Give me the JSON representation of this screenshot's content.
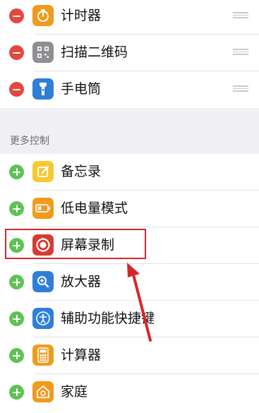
{
  "included_controls": [
    {
      "label": "计时器",
      "icon": "timer-icon",
      "color": "#f19a1c"
    },
    {
      "label": "扫描二维码",
      "icon": "qr-code-icon",
      "color": "#8e8e93"
    },
    {
      "label": "手电筒",
      "icon": "flashlight-icon",
      "color": "#2f7ed8"
    }
  ],
  "more_controls": {
    "header": "更多控制",
    "items": [
      {
        "label": "备忘录",
        "icon": "notes-icon",
        "color": "#f8c830"
      },
      {
        "label": "低电量模式",
        "icon": "battery-icon",
        "color": "#f19a1c"
      },
      {
        "label": "屏幕录制",
        "icon": "screen-record-icon",
        "color": "#d83b30"
      },
      {
        "label": "放大器",
        "icon": "magnifier-icon",
        "color": "#2f7ed8"
      },
      {
        "label": "辅助功能快捷键",
        "icon": "accessibility-icon",
        "color": "#2f7ed8"
      },
      {
        "label": "计算器",
        "icon": "calculator-icon",
        "color": "#f19a1c"
      },
      {
        "label": "家庭",
        "icon": "home-icon",
        "color": "#f19a1c"
      }
    ]
  },
  "colors": {
    "remove": "#e5473d",
    "add": "#5ec354",
    "annotation": "#d6262a",
    "section_bg": "#efeff4"
  }
}
